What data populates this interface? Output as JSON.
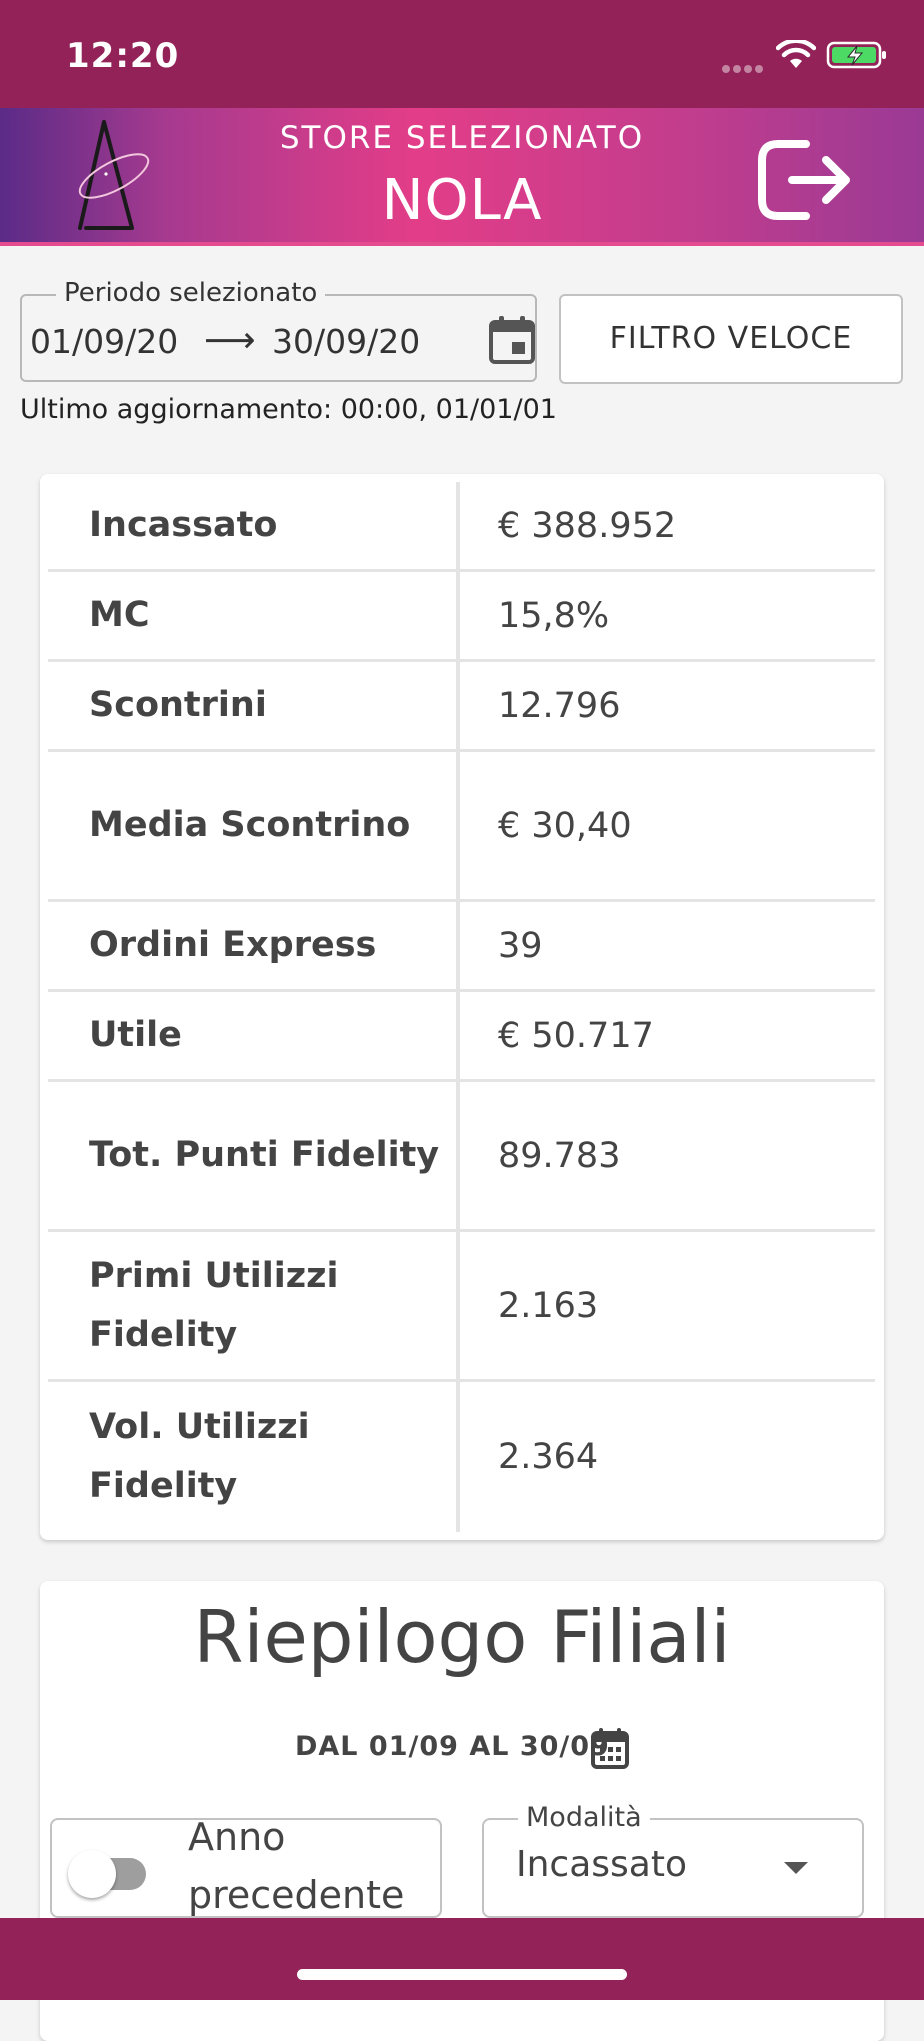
{
  "status_bar": {
    "time": "12:20"
  },
  "header": {
    "store_label": "STORE SELEZIONATO",
    "store_name": "NOLA",
    "logo_icon": "brand-logo-icon",
    "logout_icon": "logout-icon"
  },
  "period": {
    "legend": "Periodo selezionato",
    "start_date": "01/09/20",
    "arrow": "⟶",
    "end_date": "30/09/20",
    "calendar_icon": "calendar-icon"
  },
  "quick_filter_label": "FILTRO VELOCE",
  "last_update": "Ultimo aggiornamento: 00:00, 01/01/01",
  "kpis": [
    {
      "label": "Incassato",
      "value": "€ 388.952"
    },
    {
      "label": "MC",
      "value": "15,8%"
    },
    {
      "label": "Scontrini",
      "value": "12.796"
    },
    {
      "label": "Media Scontrino",
      "value": "€ 30,40"
    },
    {
      "label": "Ordini Express",
      "value": "39"
    },
    {
      "label": "Utile",
      "value": "€ 50.717"
    },
    {
      "label": "Tot. Punti Fidelity",
      "value": "89.783"
    },
    {
      "label": "Primi Utilizzi Fidelity",
      "value": "2.163"
    },
    {
      "label": "Vol. Utilizzi Fidelity",
      "value": "2.364"
    }
  ],
  "summary": {
    "title": "Riepilogo Filiali",
    "range": "DAL 01/09 AL 30/09",
    "previous_year_toggle": {
      "label": "Anno precedente",
      "checked": false
    },
    "mode": {
      "legend": "Modalità",
      "value": "Incassato"
    }
  },
  "colors": {
    "status_bar": "#922257",
    "header_gradient_start": "#5a2b87",
    "header_gradient_mid": "#e33d88",
    "accent_border": "#e54b8f",
    "background": "#f4f4f4"
  }
}
